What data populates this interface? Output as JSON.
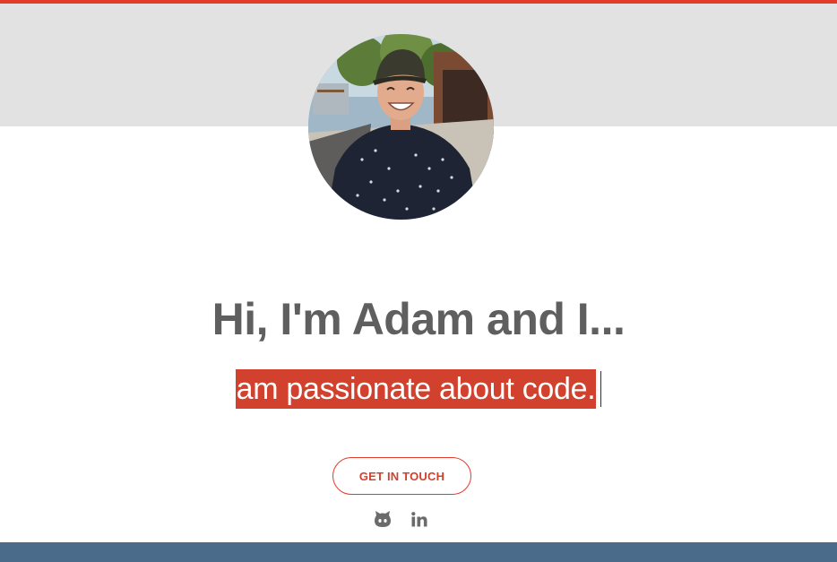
{
  "profile": {
    "avatar_alt": "Adam smiling outdoors"
  },
  "hero": {
    "headline": "Hi, I'm Adam and I...",
    "typed_text": "am passionate about code."
  },
  "actions": {
    "cta_label": "GET IN TOUCH"
  },
  "social": {
    "github_icon": "github-icon",
    "linkedin_icon": "linkedin-icon"
  },
  "colors": {
    "accent": "#e23b2a",
    "highlight": "#d1412e",
    "header_band": "#e2e2e2",
    "footer_band": "#4a6b8a",
    "headline_text": "#5f5f5f"
  }
}
